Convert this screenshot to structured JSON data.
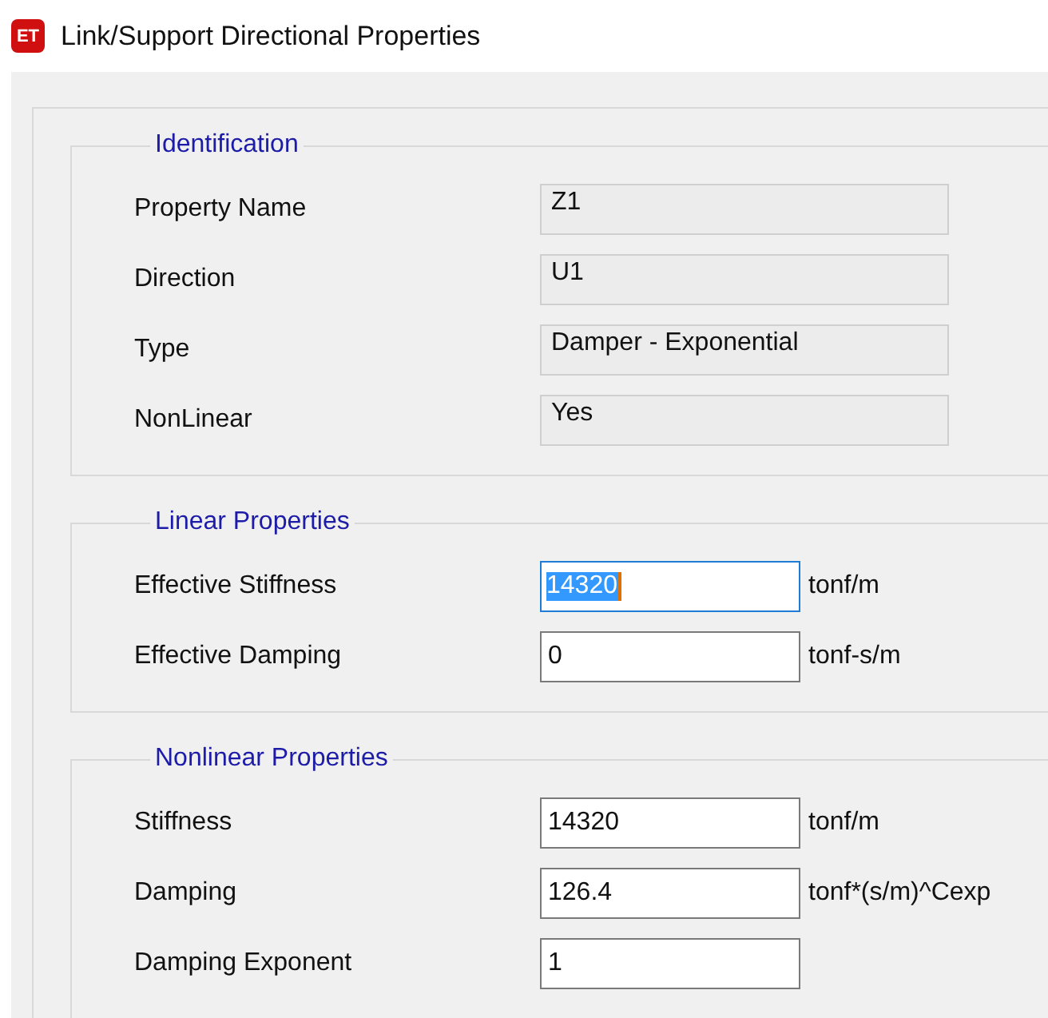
{
  "window": {
    "title": "Link/Support Directional Properties",
    "icon_text": "ET"
  },
  "groups": [
    {
      "title": "Identification",
      "rows": [
        {
          "label": "Property Name",
          "value": "Z1",
          "kind": "readonly",
          "focused": false
        },
        {
          "label": "Direction",
          "value": "U1",
          "kind": "readonly",
          "focused": false
        },
        {
          "label": "Type",
          "value": "Damper - Exponential",
          "kind": "readonly",
          "focused": false
        },
        {
          "label": "NonLinear",
          "value": "Yes",
          "kind": "readonly",
          "focused": false
        }
      ]
    },
    {
      "title": "Linear Properties",
      "rows": [
        {
          "label": "Effective Stiffness",
          "value": "14320",
          "unit": "tonf/m",
          "kind": "edit",
          "focused": true
        },
        {
          "label": "Effective Damping",
          "value": "0",
          "unit": "tonf-s/m",
          "kind": "edit",
          "focused": false
        }
      ]
    },
    {
      "title": "Nonlinear Properties",
      "rows": [
        {
          "label": "Stiffness",
          "value": "14320",
          "unit": "tonf/m",
          "kind": "edit",
          "focused": false
        },
        {
          "label": "Damping",
          "value": "126.4",
          "unit": "tonf*(s/m)^Cexp",
          "kind": "edit",
          "focused": false
        },
        {
          "label": "Damping Exponent",
          "value": "1",
          "kind": "edit",
          "focused": false
        }
      ]
    }
  ]
}
